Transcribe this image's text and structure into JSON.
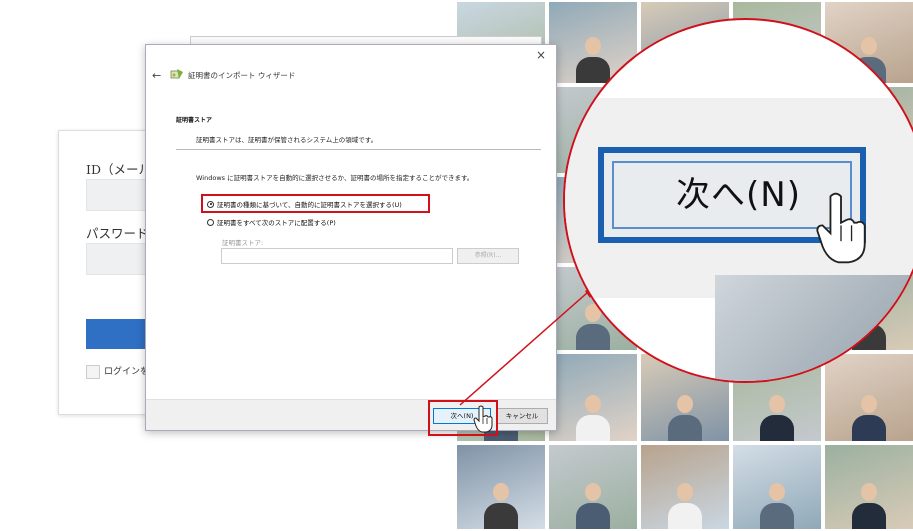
{
  "login": {
    "id_label": "ID（メールア",
    "password_label": "パスワード",
    "remember_label": "ログインを"
  },
  "wizard": {
    "close_glyph": "×",
    "back_glyph": "←",
    "title": "証明書のインポート ウィザード",
    "section_heading": "証明書ストア",
    "section_description": "証明書ストアは、証明書が保管されるシステム上の領域です。",
    "intro": "Windows に証明書ストアを自動的に選択させるか、証明書の場所を指定することができます。",
    "option_auto": "証明書の種類に基づいて、自動的に証明書ストアを選択する(U)",
    "option_manual": "証明書をすべて次のストアに配置する(P)",
    "store_label": "証明書ストア:",
    "store_value": "",
    "browse_button": "参照(R)...",
    "next_button": "次へ(N)",
    "cancel_button": "キャンセル",
    "selected_option": "auto"
  },
  "zoom": {
    "next_button": "次へ(N)",
    "cursor_icon": "hand-pointer-icon"
  },
  "colors": {
    "highlight_red": "#d0101b",
    "focus_blue": "#1b60b0",
    "login_button_blue": "#2f6fc4"
  }
}
